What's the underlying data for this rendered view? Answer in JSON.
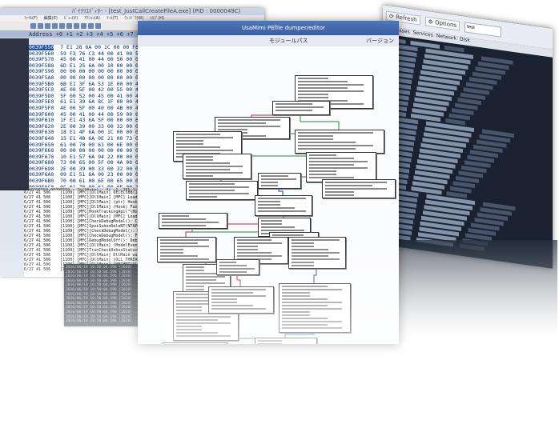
{
  "debugger": {
    "title": "ﾊﾞｲﾅﾘｴﾃﾞｨﾀｰ - [test_JustCallCreateFileA.exe] (PID : 0000049C)",
    "menu": [
      "ﾌｧｲﾙ(F)",
      "編集(E)",
      "ﾋﾞｭｰ(V)",
      "ｱｸｼｮﾝ(A)",
      "ﾂｰﾙ(T)",
      "ｳｨﾝﾄﾞｳ(W)",
      "ﾍﾙﾌﾟ(H)"
    ],
    "hex_header": "Address   +0 +1 +2 +3 +4 +5 +6 +7 +8 +9 +A +B +C +D +E +F  0123456789ABCDEF",
    "addresses": [
      "0039F550",
      "0039F560",
      "0039F570",
      "0039F580",
      "0039F590",
      "0039F5A0",
      "0039F5B0",
      "0039F5C0",
      "0039F5D0",
      "0039F5E0",
      "0039F5F0",
      "0039F600",
      "0039F610",
      "0039F620",
      "0039F630",
      "0039F640",
      "0039F650",
      "0039F660",
      "0039F670",
      "0039F680",
      "0039F690",
      "0039F6A0",
      "0039F6B0",
      "0039F6C0",
      "0039F6D0"
    ],
    "hex_rows": [
      "7 E1 28 6A 00 1C 00 00 F8",
      "59 F3 76 C3 44 00 41 00 54",
      "45 00 41 00 44 00 50 00 00",
      "6D E1 25 6A 00 10 00 00 00",
      "00 00 00 00 00 00 00 00 00",
      "00 00 00 00 00 00 00 00 00",
      "6B E1 3F 6A 53 1E 00 00 44",
      "4E 00 5F 00 42 00 55 00 45",
      "5F 00 52 00 45 00 41 00 44",
      "61 E1 39 6A 8C 1F 00 00 44",
      "4E 00 5F 00 40 00 4B 00 45",
      "45 00 41 00 44 00 59 00 00",
      "1F E1 43 6A 5F 00 00 00 61",
      "2E 00 39 00 33 00 32 00 00",
      "18 E1 4F 6A 00 1C 00 00 00",
      "15 E1 40 6A 0E 21 00 73 00",
      "61 00 70 00 61 00 6E 00 00",
      "00 00 00 00 00 00 00 00 00",
      "10 E1 57 6A 94 22 00 00 00",
      "73 00 65 00 5F 00 4A 00 00",
      "2E 00 39 00 33 00 32 00 00",
      "09 E1 51 6A 00 23 00 00 00",
      "70 00 61 00 6E 00 65 00 00",
      "0C 61 70 00 61 00 6E 00 2E",
      "F7 E1 58 6A 06 24 00 00 00"
    ],
    "status": "0039F550-0039F550 : 1h(1Byte) : 0( -1, 255 ), 'R( 9727, 9727 )"
  },
  "graph_window": {
    "title": "UsaMimi PEfile dumper/editor",
    "module_label": "モジュールパス",
    "version_label": "バージョン"
  },
  "log": {
    "lines": [
      "6/27 41 506    [1100] [MFC][DllMain] 6ECEC5BB(1) MaRetry ...",
      "6/27 41 506    [1100] [MFC][DllMain] [MFC] LoadLibraryA done",
      "6/27 41 506    [1100] [MFC][DllMain] (ptr) HookFunction to 0x590...",
      "6/27 41 506    [1100] [MFC][DllMain] (Hook) FunctionA: this",
      "6/27 41 506    [1100] [MFC]HookTrackingApi(\"\\Hook\") asking",
      "6/27 41 506    [1100] [MFC][DllMain] [MFC] LoadLibraryA done",
      "6/27 41 506    [1100] [MFC]CheckDebugModel(): ChelkDebugModel",
      "6/27 41 506    [1100] [MFC]SpoiSubenDeleNT(NTAPIDll",
      "6/27 41 506    [1100] [MFC][CheckDebugModel(): MayUserVisitabl",
      "6/27 41 506    [1100] [MFC]CheckDebugModel(): Failed to get retu",
      "6/27 41 506    [1100] [MFC]DebugModelOff(): DebugModelOff ret",
      "6/27 41 506    [1100] [MFC][DllMain] (ModelEvent) is 6/394",
      "6/27 41 506    [1100] [MFC]TrunCheckUnboxStatusRoutine(0 hook",
      "6/27 41 506    [1100] [MFC][DllMain] DllMain was called",
      "6/27 41 506    [1100] [MFC][DllMain] [DLL_THREAD_DETACH]",
      "6/27 41 506    [1100] [MFC][DllMain] [MFCHMT[DLL_THREAD_DETA",
      "6/27 41 506    [1100] [MFC][DllMain] [MFCModule][DLL_THREAD_D"
    ]
  },
  "bottom_log": {
    "lines": [
      "2016/06/19 10:50:04.596 [2020] ...",
      "2016/06/19 10:50:04.596 [2020] ...",
      "2016/06/19 10:50:04.596 [2020] ...",
      "2016/06/19 10:50:04.596 [2020] ...",
      "2016/06/19 10:50:04.596 [2020] ...",
      "2016/06/19 10:50:04.596 [2020] ...",
      "2016/06/19 10:50:04.596 [2020] ...",
      "2016/06/19 10:50:04.596 [2020] ...",
      "2016/06/19 10:50:04.596 [2020] ...",
      "2016/06/19 10:50:04.596 [2020] ...",
      "2016/06/19 10:50:04.596 [2020] ...",
      "2016/06/19 10:50:04.596 [2020] ...",
      "2016/06/19 10:50:04.596 [2020] ..."
    ]
  },
  "process_window": {
    "refresh_label": "Refresh",
    "options_label": "Options",
    "search_value": "test",
    "tabs": [
      "Processes",
      "Services",
      "Network",
      "Disk"
    ]
  },
  "colors": {
    "graph_edge_true": "#2a8a2a",
    "graph_edge_false": "#c62828",
    "graph_edge_uncond": "#1f3fa8"
  }
}
